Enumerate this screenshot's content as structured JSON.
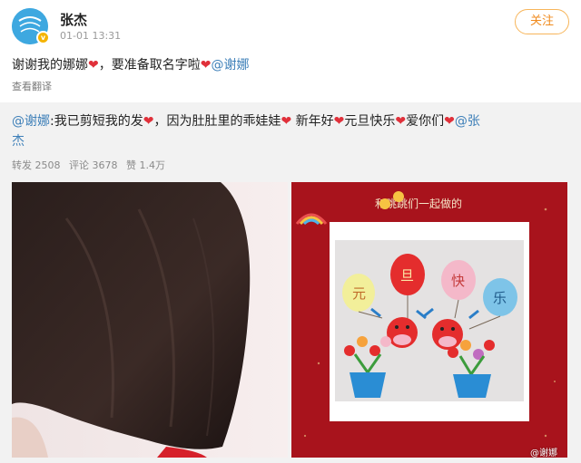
{
  "header": {
    "username": "张杰",
    "timestamp": "01-01 13:31",
    "follow_label": "关注",
    "avatar_icon": "cartoon-avatar-icon",
    "verified_icon": "verified-badge-icon"
  },
  "post": {
    "text_part1": "谢谢我的娜娜",
    "text_part2": "，要准备取名字啦",
    "mention": "@谢娜",
    "heart_glyph": "❤",
    "translate_label": "查看翻译"
  },
  "repost": {
    "mention_lead": "@谢娜",
    "text_a": ":我已剪短我的发",
    "text_b": "，因为肚肚里的乖娃娃",
    "text_c": " 新年好",
    "text_d": "元旦快乐",
    "text_e": "爱你们",
    "mention_tail_1": "@张",
    "mention_tail_2": "杰",
    "stats": {
      "repost": "转发 2508",
      "comment": "评论 3678",
      "like": "赞 1.4万"
    }
  },
  "photos": {
    "left_subject": "short-hair-back-of-head",
    "right_subject": "new-year-card-balloons",
    "card_handwriting": "和跳跳们一起做的",
    "balloon_chars": [
      "元",
      "旦",
      "快",
      "乐"
    ]
  },
  "watermark": "@谢娜",
  "colors": {
    "follow_border": "#f7b55a",
    "follow_text": "#f08a1c",
    "mention": "#3d7fb8",
    "heart": "#e0303a",
    "card_background": "#a8131c"
  }
}
